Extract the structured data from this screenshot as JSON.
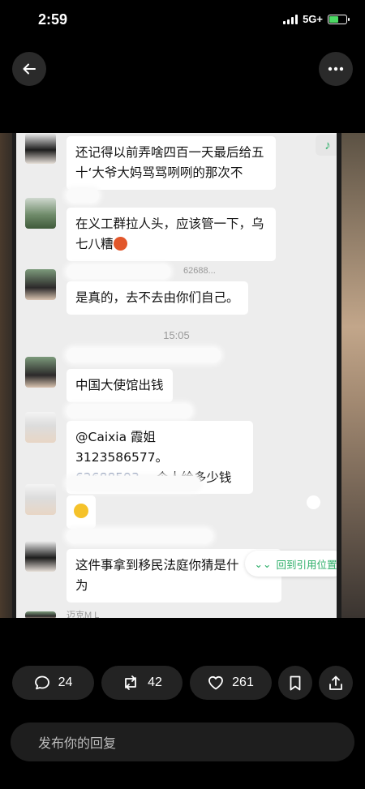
{
  "status": {
    "time": "2:59",
    "network": "5G+"
  },
  "chat": {
    "messages": [
      {
        "text": "还记得以前弄啥四百一天最后给五十‘大爷大妈骂骂咧咧的那次不"
      },
      {
        "text_line1": "在义工群拉人头，应该管一下，乌",
        "text_line2": "七八糟"
      },
      {
        "name_suffix": "62688...",
        "text": "是真的，去不去由你们自己。"
      },
      {
        "text": "中国大使馆出钱"
      },
      {
        "text_line1": "@Caixia 霞姐3123586577。",
        "text_line2_link": "62688593",
        "text_line2_rest": " 一个人给多少钱"
      },
      {
        "text": "这件事拿到移民法庭你猜是什",
        "text_line2": "为"
      }
    ],
    "timestamp": "15:05",
    "partial_name": "迈克M L",
    "jump_button": "回到引用位置"
  },
  "actions": {
    "comments": "24",
    "reposts": "42",
    "likes": "261"
  },
  "reply": {
    "placeholder": "发布你的回复"
  }
}
